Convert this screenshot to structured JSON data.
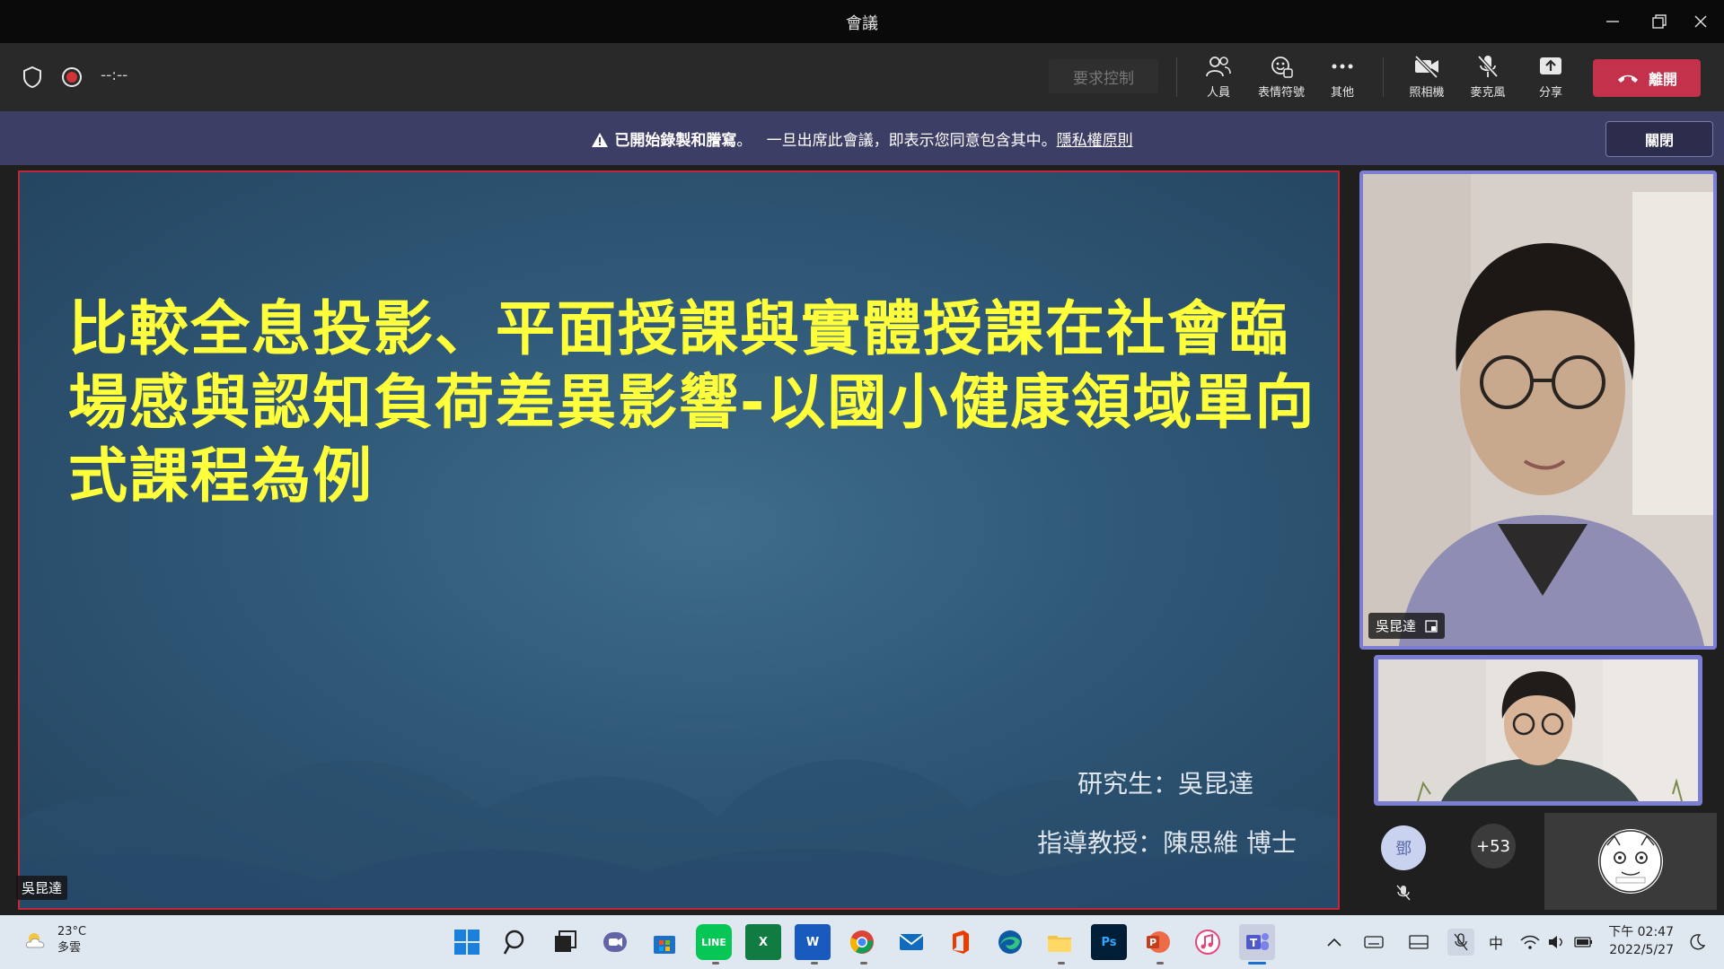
{
  "window": {
    "title": "會議"
  },
  "toolbar": {
    "timer": "--:--",
    "request_control": "要求控制",
    "people": "人員",
    "reactions": "表情符號",
    "more": "其他",
    "camera": "照相機",
    "mic": "麥克風",
    "share": "分享",
    "leave": "離開"
  },
  "banner": {
    "title": "已開始錄製和謄寫",
    "separator": "。",
    "message": "一旦出席此會議，即表示您同意包含其中。",
    "privacy_link": "隱私權原則",
    "close": "關閉"
  },
  "slide": {
    "title": "比較全息投影、平面授課與實體授課在社會臨場感與認知負荷差異影響-以國小健康領域單向式課程為例",
    "author": "研究生：吳昆達",
    "advisor": "指導教授：陳思維 博士",
    "presenter_tag": "吳昆達"
  },
  "participants": {
    "main_name": "吳昆達",
    "avatar_initial": "鄧",
    "overflow_count": "+53",
    "highlight_color": "#7c7ed4"
  },
  "taskbar": {
    "weather_temp": "23°C",
    "weather_desc": "多雲",
    "ime": "中",
    "time": "下午 02:47",
    "date": "2022/5/27",
    "apps": [
      "windows-start",
      "search",
      "task-view",
      "teams-chat",
      "microsoft-store",
      "line",
      "excel",
      "word",
      "chrome",
      "mail",
      "office",
      "edge",
      "file-explorer",
      "photoshop",
      "powerpoint",
      "itunes",
      "teams"
    ]
  },
  "colors": {
    "leave_red": "#c4314b",
    "banner_bg": "#3d3e66",
    "slide_title_yellow": "#ffff3b"
  }
}
